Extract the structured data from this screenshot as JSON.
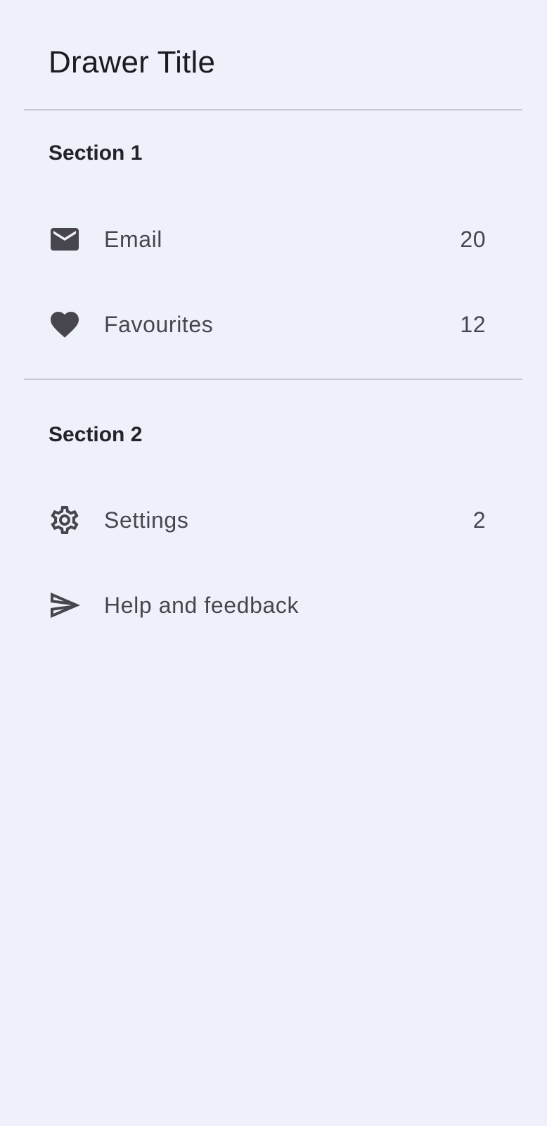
{
  "drawer": {
    "title": "Drawer Title",
    "colors": {
      "background": "#eef0fa",
      "text_primary": "#1c1b22",
      "text_secondary": "#47464f",
      "icon": "#47464f",
      "divider": "#c7c8d0"
    },
    "sections": [
      {
        "header": "Section 1",
        "items": [
          {
            "label": "Email",
            "icon": "mail-icon",
            "badge": "20"
          },
          {
            "label": "Favourites",
            "icon": "heart-icon",
            "badge": "12"
          }
        ]
      },
      {
        "header": "Section 2",
        "items": [
          {
            "label": "Settings",
            "icon": "gear-icon",
            "badge": "2"
          },
          {
            "label": "Help and feedback",
            "icon": "send-icon",
            "badge": ""
          }
        ]
      }
    ]
  }
}
